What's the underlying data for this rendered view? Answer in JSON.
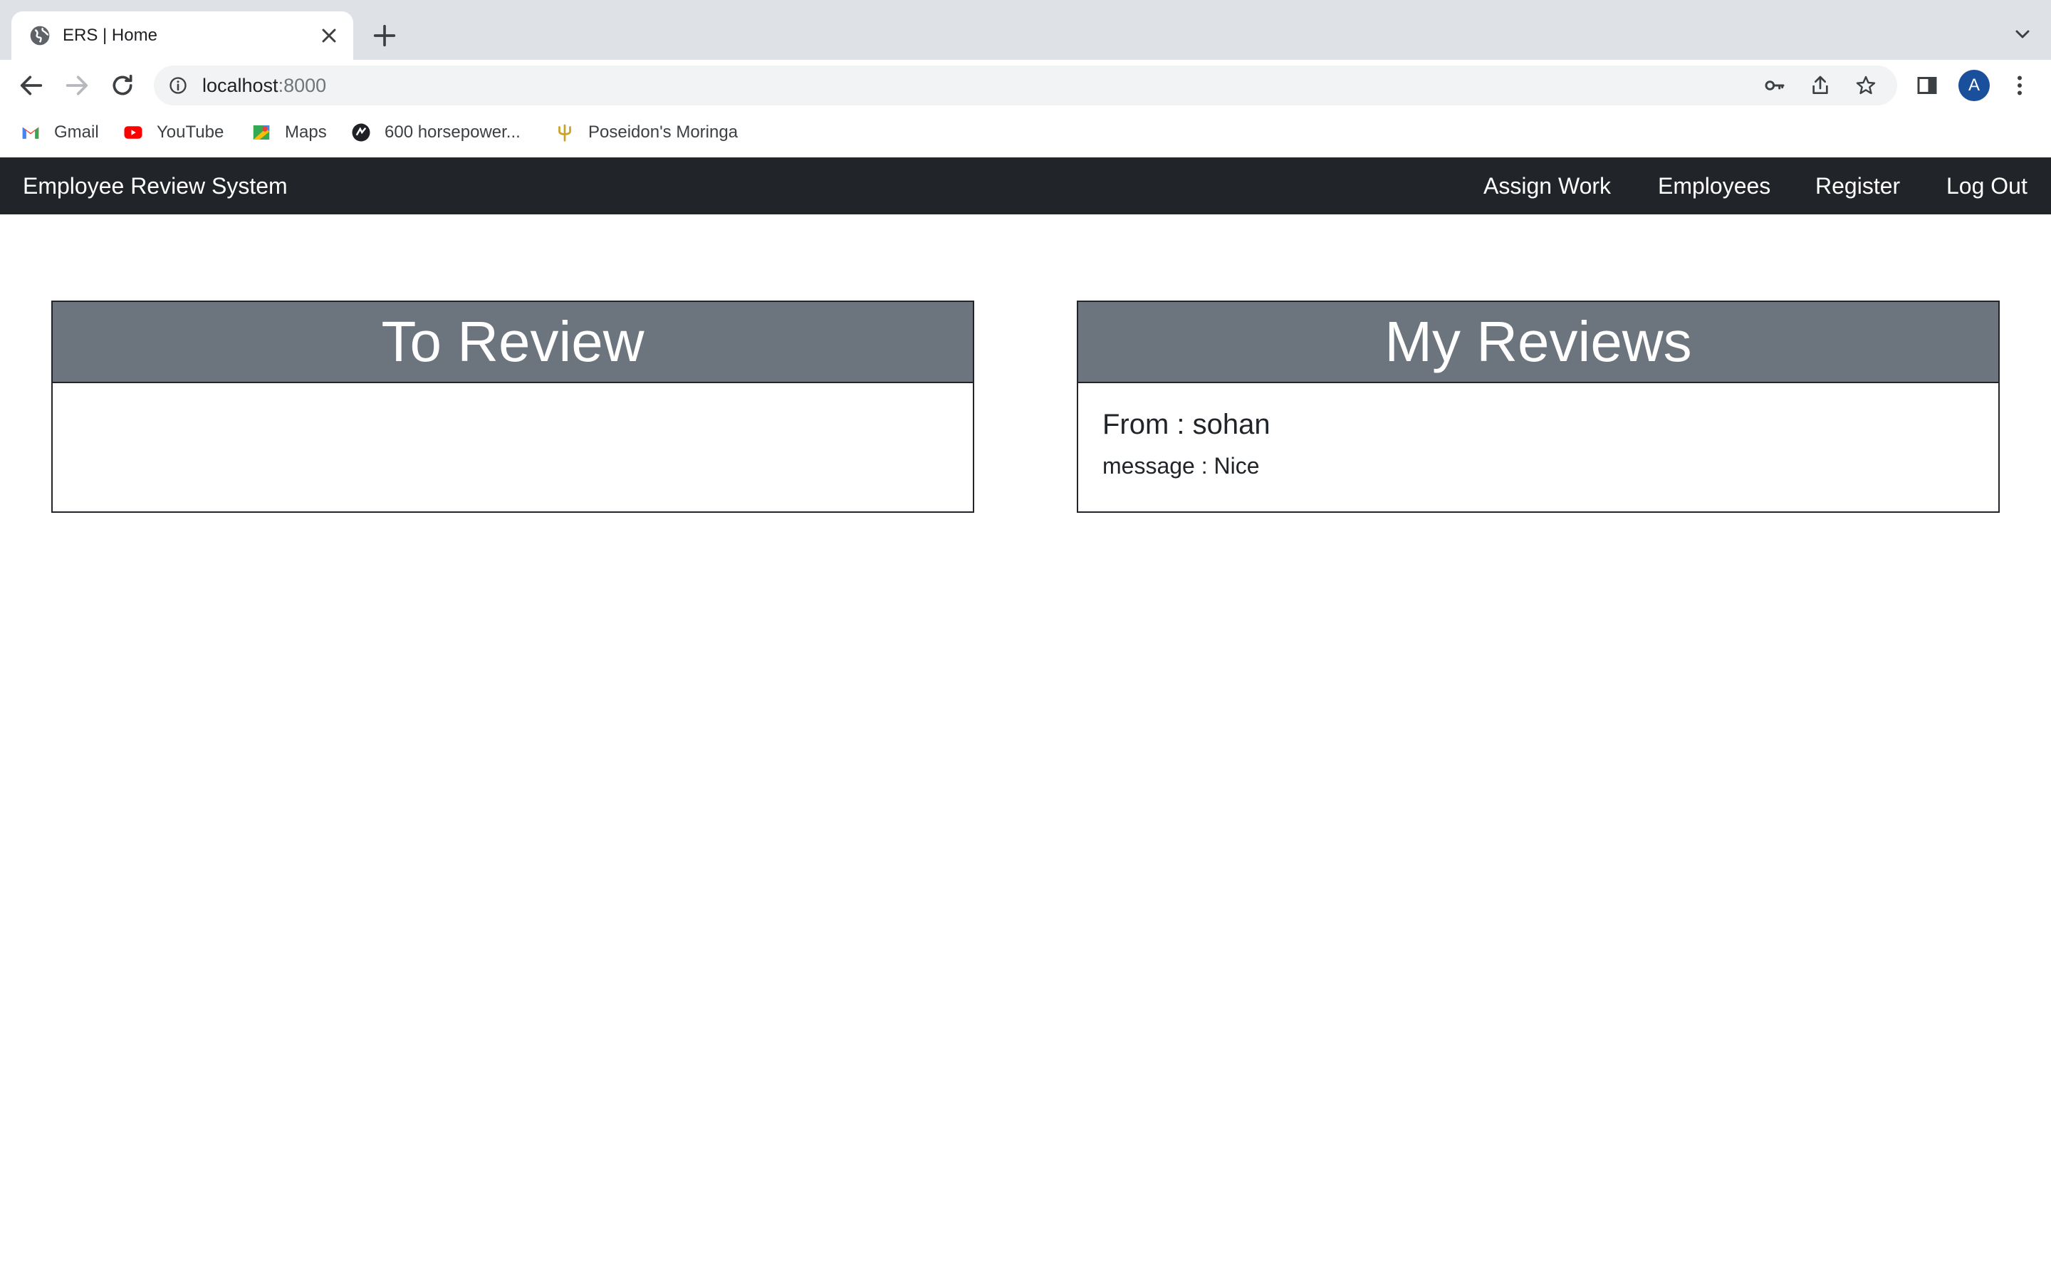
{
  "browser": {
    "tab": {
      "title": "ERS | Home"
    },
    "address": {
      "host": "localhost",
      "port": ":8000"
    },
    "avatar_letter": "A",
    "bookmarks": [
      {
        "label": "Gmail",
        "icon": "gmail-icon"
      },
      {
        "label": "YouTube",
        "icon": "youtube-icon"
      },
      {
        "label": "Maps",
        "icon": "maps-icon"
      },
      {
        "label": "600 horsepower...",
        "icon": "site-icon"
      },
      {
        "label": "Poseidon's Moringa",
        "icon": "trident-icon"
      }
    ]
  },
  "app": {
    "brand": "Employee Review System",
    "nav": {
      "assign_work": "Assign Work",
      "employees": "Employees",
      "register": "Register",
      "logout": "Log Out"
    },
    "to_review": {
      "title": "To Review",
      "items": []
    },
    "my_reviews": {
      "title": "My Reviews",
      "items": [
        {
          "from": "From : sohan",
          "message": "message : Nice"
        }
      ]
    }
  },
  "colors": {
    "navbar_bg": "#212529",
    "card_header_bg": "#6c757d",
    "tabstrip_bg": "#dee1e6"
  }
}
